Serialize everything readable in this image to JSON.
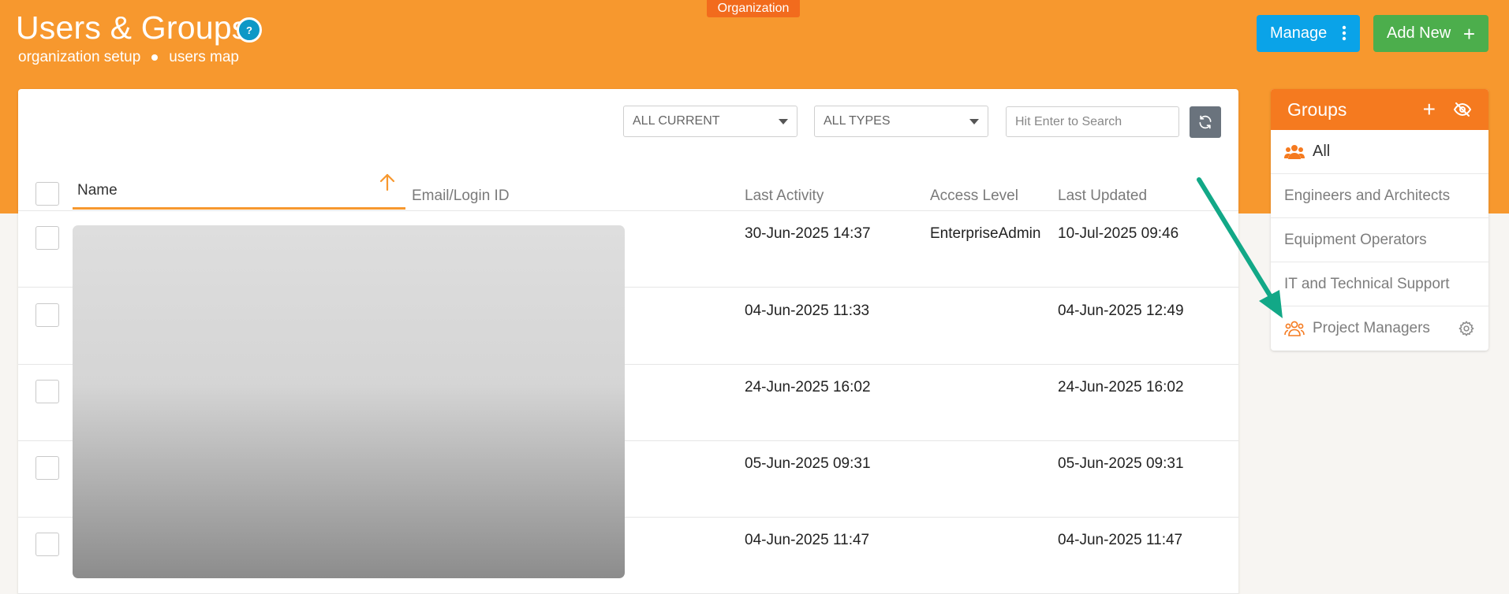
{
  "header": {
    "org_tag": "Organization",
    "title": "Users & Groups",
    "help_glyph": "?",
    "breadcrumb": [
      "organization setup",
      "users map"
    ],
    "manage_label": "Manage",
    "add_new_label": "Add New"
  },
  "filters": {
    "status": "ALL CURRENT",
    "type": "ALL TYPES",
    "search_placeholder": "Hit Enter to Search"
  },
  "table": {
    "columns": {
      "name": "Name",
      "email": "Email/Login ID",
      "last_activity": "Last Activity",
      "access_level": "Access Level",
      "last_updated": "Last Updated"
    },
    "rows": [
      {
        "last_activity": "30-Jun-2025 14:37",
        "access_level": "EnterpriseAdmin",
        "last_updated": "10-Jul-2025 09:46"
      },
      {
        "last_activity": "04-Jun-2025 11:33",
        "access_level": "",
        "last_updated": "04-Jun-2025 12:49"
      },
      {
        "last_activity": "24-Jun-2025 16:02",
        "access_level": "",
        "last_updated": "24-Jun-2025 16:02"
      },
      {
        "last_activity": "05-Jun-2025 09:31",
        "access_level": "",
        "last_updated": "05-Jun-2025 09:31"
      },
      {
        "last_activity": "04-Jun-2025 11:47",
        "access_level": "",
        "last_updated": "04-Jun-2025 11:47"
      }
    ]
  },
  "groups": {
    "title": "Groups",
    "items": [
      {
        "label": "All",
        "icon": "users-icon"
      },
      {
        "label": "Engineers and Architects"
      },
      {
        "label": "Equipment Operators"
      },
      {
        "label": "IT and Technical Support"
      },
      {
        "label": "Project Managers",
        "icon": "users-outline-icon",
        "action_icon": "gear-icon"
      }
    ]
  },
  "colors": {
    "header_orange": "#f7982e",
    "groups_orange": "#f57a1f",
    "manage_blue": "#0aa3e8",
    "add_green": "#4cae4c",
    "annotation_teal": "#12a887"
  }
}
